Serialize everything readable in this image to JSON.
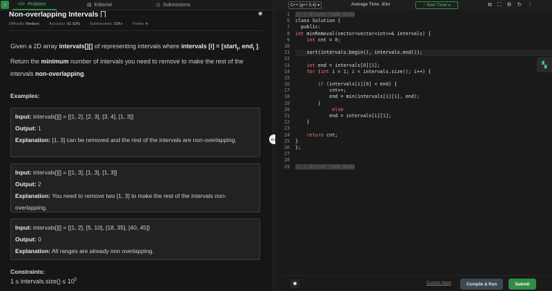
{
  "tabs": {
    "problem": "Problem",
    "editorial": "Editorial",
    "submissions": "Submissions"
  },
  "problem": {
    "title": "Non-overlapping Intervals",
    "difficulty_label": "Difficulty:",
    "difficulty": "Medium",
    "accuracy_label": "Accuracy:",
    "accuracy": "51.92%",
    "submissions_label": "Submissions:",
    "submissions": "32K+",
    "points_label": "Points:",
    "points": "4",
    "desc_1": "Given a 2D array ",
    "desc_2": "intervals[][]",
    "desc_3": " of representing intervals where ",
    "desc_4": "intervals [i] = [start",
    "desc_4_sub": "i",
    "desc_5": ", end",
    "desc_5_sub": "i",
    "desc_6": " ]",
    "desc_7": ". Return the ",
    "desc_8": "minimum",
    "desc_9": " number of intervals you need to remove to make the rest of the intervals ",
    "desc_10": "non-overlapping",
    "desc_11": ".",
    "examples_heading": "Examples:",
    "input_label": "Input:",
    "output_label": "Output:",
    "explanation_label": "Explanation:",
    "examples": [
      {
        "input": " intervals[][] = [[1, 2], [2, 3], [3, 4], [1, 3]]",
        "output": " 1",
        "explanation": " [1, 3] can be removed and the rest of the intervals are non-overlapping."
      },
      {
        "input": " intervals[][] = [[1, 3], [1, 3], [1, 3]]",
        "output": " 2",
        "explanation": " You need to remove two [1, 3] to make the rest of the intervals non-overlapping."
      },
      {
        "input": " intervals[][] = [[1, 2], [5, 10], [18, 35], [40, 45]]",
        "output": " 0",
        "explanation": " All ranges are already non overlapping."
      }
    ],
    "constraints_heading": "Constraints:",
    "constraint_1": "1 ≤ intervals.size() ≤  10",
    "constraint_1_sup": "5"
  },
  "editor": {
    "language": "C++ (g++ 5.4)",
    "avg_time": "Average Time: 30m",
    "timer": "Start Timer",
    "line_numbers": [
      "1",
      "6",
      "7",
      "8",
      "9",
      "10",
      "11",
      "12",
      "13",
      "14",
      "15",
      "16",
      "17",
      "18",
      "19",
      "20",
      "21",
      "22",
      "23",
      "24",
      "25",
      "26",
      "27",
      "28",
      "29"
    ],
    "lines": {
      "l1": "// } Driver Code Ends",
      "l6": "class Solution {",
      "l7": "  public:",
      "l8a": "int",
      "l8b": " minRemoval(vector<vector<int>>& intervals) {",
      "l9a": "int",
      "l9b": " cnt = ",
      "l9c": "0",
      "l9d": ";",
      "l11": "sort(intervals.begin(), intervals.end());",
      "l13a": "int",
      "l13b": " end = intervals[",
      "l13c": "0",
      "l13d": "][",
      "l13e": "1",
      "l13f": "];",
      "l14a": "for",
      "l14b": " (",
      "l14c": "int",
      "l14d": " i = ",
      "l14e": "1",
      "l14f": "; i < intervals.size(); i++) {",
      "l16a": "if",
      "l16b": " (intervals[i][",
      "l16c": "0",
      "l16d": "] < end) {",
      "l17": "cnt++;",
      "l18a": "end = min(intervals[i][",
      "l18b": "1",
      "l18c": "], end);",
      "l19": "}",
      "l20": "else",
      "l21a": "end = intervals[i][",
      "l21b": "1",
      "l21c": "];",
      "l22": "}",
      "l24a": "return",
      "l24b": " cnt;",
      "l25": "}",
      "l26": "};",
      "l29": "// { Driver Code Ends"
    },
    "custom_input": "Custom Input",
    "compile_run": "Compile & Run",
    "submit": "Submit"
  }
}
